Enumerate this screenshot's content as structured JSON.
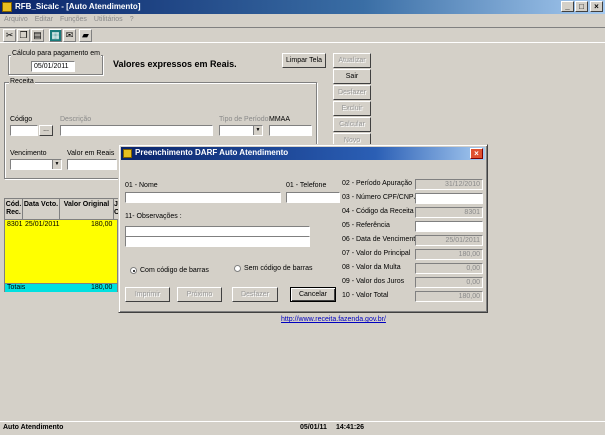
{
  "window": {
    "title": "RFB_Sicalc - [Auto Atendimento]"
  },
  "menu": [
    "Arquivo",
    "Editar",
    "Funções",
    "Utilitários",
    "?"
  ],
  "main": {
    "calc_group_label": "Cálculo para pagamento em",
    "calc_date": "05/01/2011",
    "currency_text": "Valores expressos em Reais.",
    "buttons": {
      "limpar": "Limpar Tela",
      "atualizar": "Atualizar",
      "sair": "Sair",
      "desfazer": "Desfazer",
      "excluir": "Excluir",
      "calcular": "Calcular",
      "novo": "Novo"
    },
    "receita": {
      "group_label": "Receita",
      "codigo_label": "Código",
      "descricao_label": "Descrição",
      "tipo_periodo_label": "Tipo de Período",
      "mmaa_label": "MMAA",
      "vencimento_label": "Vencimento",
      "valor_reais_label": "Valor em Reais",
      "browse_label": "..."
    },
    "grid": {
      "headers": [
        "Cód. Rec.",
        "Data Vcto.",
        "Valor Original",
        "Ju Ou"
      ],
      "rows": [
        [
          "8301",
          "25/01/2011",
          "180,00"
        ]
      ],
      "totals_label": "Totais",
      "totals_value": "180,00"
    },
    "link": "http://www.receita.fazenda.gov.br/"
  },
  "dialog": {
    "title": "Preenchimento DARF Auto Atendimento",
    "nome_label": "01 - Nome",
    "telefone_label": "01 - Telefone",
    "obs_label": "11- Observações :",
    "radio_com": "Com código de barras",
    "radio_sem": "Sem código de barras",
    "buttons": {
      "imprimir": "Imprimir",
      "proximo": "Próximo",
      "desfazer": "Desfazer",
      "cancelar": "Cancelar"
    },
    "fields": [
      {
        "label": "02 - Período  Apuração",
        "value": "31/12/2010"
      },
      {
        "label": "03 - Número  CPF/CNPJ",
        "value": ""
      },
      {
        "label": "04 - Código da Receita",
        "value": "8301"
      },
      {
        "label": "05 - Referência",
        "value": ""
      },
      {
        "label": "06 - Data de Vencimento",
        "value": "25/01/2011"
      },
      {
        "label": "07 - Valor do Principal",
        "value": "180,00"
      },
      {
        "label": "08 - Valor da Multa",
        "value": "0,00"
      },
      {
        "label": "09 - Valor dos Juros",
        "value": "0,00"
      },
      {
        "label": "10 - Valor Total",
        "value": "180,00"
      }
    ]
  },
  "status": {
    "left": "Auto Atendimento",
    "date": "05/01/11",
    "time": "14:41:26"
  },
  "colors": {
    "grid_rows": "#ffff00",
    "totals": "#00e0e0",
    "title": "#0a246a"
  }
}
